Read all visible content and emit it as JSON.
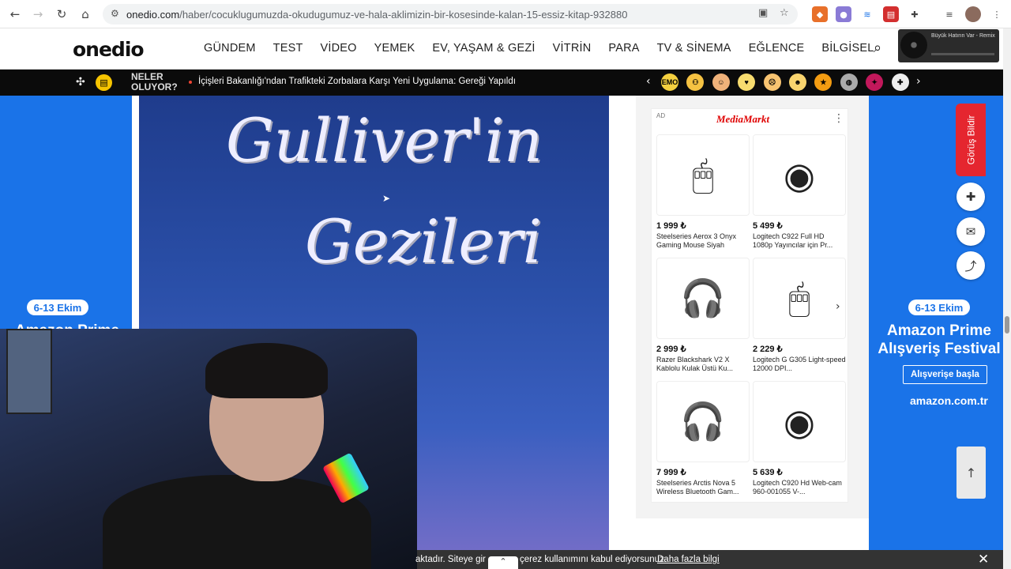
{
  "browser": {
    "url_host": "onedio.com",
    "url_path": "/haber/cocuklugumuzda-okudugumuz-ve-hala-aklimizin-bir-kosesinde-kalan-15-essiz-kitap-932880"
  },
  "site": {
    "logo": "onedio",
    "nav": [
      "GÜNDEM",
      "TEST",
      "VİDEO",
      "YEMEK",
      "EV, YAŞAM & GEZİ",
      "VİTRİN",
      "PARA",
      "TV & SİNEMA",
      "EĞLENCE",
      "BİLGİSEL"
    ]
  },
  "mini_player": {
    "title": "Büyük Hatırın Var - Remix",
    "subtitle": ""
  },
  "ticker": {
    "label_line1": "NELER",
    "label_line2": "OLUYOR?",
    "headline": "İçişleri Bakanlığı'ndan Trafikteki Zorbalara Karşı Yeni Uygulama: Gereği Yapıldı",
    "emojis": [
      {
        "name": "emoji-badge-1",
        "text": "EMO",
        "color": "#f4d03f"
      },
      {
        "name": "emoji-badge-2",
        "text": "⚇",
        "color": "#f5c242"
      },
      {
        "name": "emoji-badge-3",
        "text": "☺",
        "color": "#f0b27a"
      },
      {
        "name": "emoji-badge-4",
        "text": "♥",
        "color": "#f7dc6f"
      },
      {
        "name": "emoji-badge-5",
        "text": "☹",
        "color": "#f8c471"
      },
      {
        "name": "emoji-badge-6",
        "text": "☻",
        "color": "#f9d46e"
      },
      {
        "name": "emoji-badge-7",
        "text": "★",
        "color": "#f39c12"
      },
      {
        "name": "emoji-badge-8",
        "text": "◍",
        "color": "#aaaaaa"
      },
      {
        "name": "emoji-badge-9",
        "text": "✦",
        "color": "#c2185b"
      },
      {
        "name": "emoji-badge-10",
        "text": "✚",
        "color": "#eeeeee"
      }
    ]
  },
  "article": {
    "cover_title_1": "Gulliver'in",
    "cover_title_2": "Gezileri"
  },
  "left_ad": {
    "date": "6-13 Ekim",
    "headline": "Amazon Prime"
  },
  "right_ad": {
    "date": "6-13 Ekim",
    "headline_1": "Amazon Prime",
    "headline_2": "Alışveriş Festival",
    "button": "Alışverişe başla",
    "brand": "amazon.com.tr"
  },
  "media_markt_ad": {
    "ad_label": "AD",
    "brand": "MediaMarkt",
    "products": [
      {
        "price": "1 999 ₺",
        "name": "Steelseries Aerox 3 Onyx Gaming Mouse Siyah",
        "icon": "mouse"
      },
      {
        "price": "5 499 ₺",
        "name": "Logitech C922 Full HD 1080p Yayıncılar için Pr...",
        "icon": "webcam"
      },
      {
        "price": "2 999 ₺",
        "name": "Razer Blackshark V2 X Kablolu Kulak Üstü Ku...",
        "icon": "headset"
      },
      {
        "price": "2 229 ₺",
        "name": "Logitech G G305 Light-speed 12000 DPI...",
        "icon": "mouse"
      },
      {
        "price": "7 999 ₺",
        "name": "Steelseries Arctis Nova 5 Wireless Bluetooth Gam...",
        "icon": "headset"
      },
      {
        "price": "5 639 ₺",
        "name": "Logitech C920 Hd Web-cam 960-001055 V-...",
        "icon": "webcam"
      }
    ]
  },
  "rail": {
    "feedback": "Görüş Bildir"
  },
  "cookie": {
    "text": "aktadır. Siteye gir",
    "text2": "çerez kullanımını kabul ediyorsunuz.",
    "more": "Daha fazla bilgi"
  }
}
